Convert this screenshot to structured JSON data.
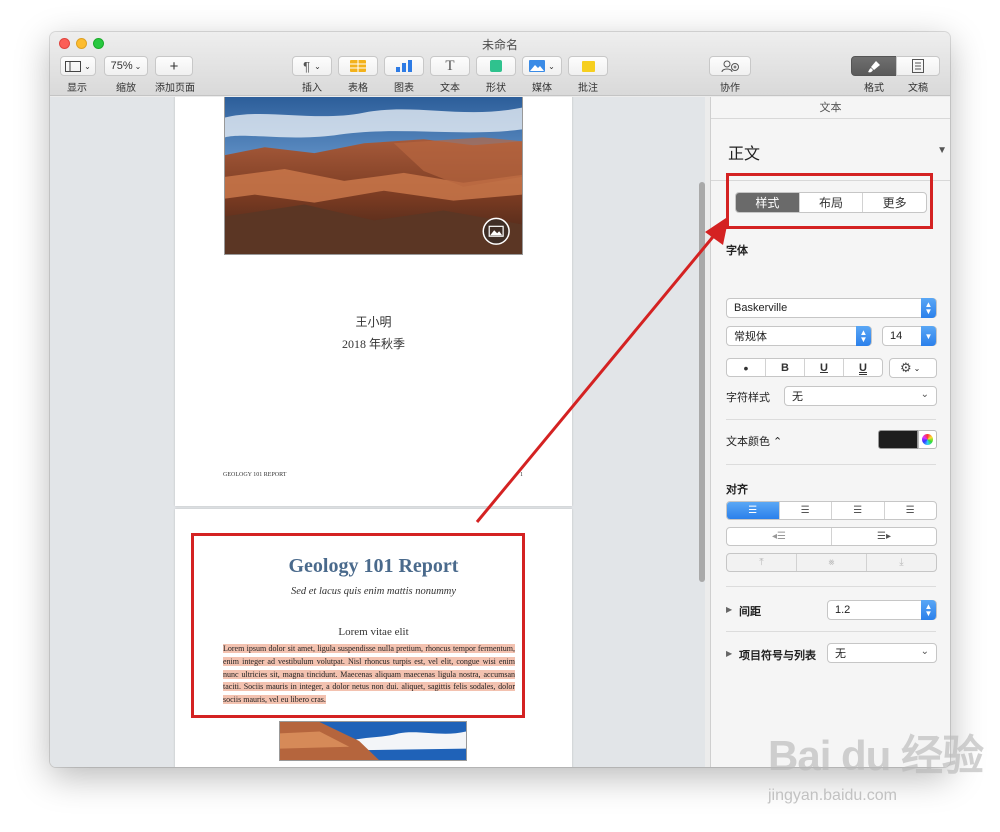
{
  "window": {
    "title": "未命名"
  },
  "toolbar": {
    "view": {
      "label": "显示",
      "icon": "sidebar-layout-icon"
    },
    "zoom": {
      "label": "缩放",
      "value": "75%"
    },
    "add_page": {
      "label": "添加页面",
      "icon": "plus-icon"
    },
    "insert": {
      "label": "插入",
      "icon": "paragraph-icon"
    },
    "table": {
      "label": "表格",
      "icon": "table-icon"
    },
    "chart": {
      "label": "图表",
      "icon": "bar-chart-icon"
    },
    "text": {
      "label": "文本",
      "icon": "text-box-icon"
    },
    "shape": {
      "label": "形状",
      "icon": "shape-icon"
    },
    "media": {
      "label": "媒体",
      "icon": "photo-icon"
    },
    "comment": {
      "label": "批注",
      "icon": "comment-icon"
    },
    "collaborate": {
      "label": "协作",
      "icon": "add-person-icon"
    },
    "format": {
      "label": "格式",
      "icon": "paintbrush-icon"
    },
    "document": {
      "label": "文稿",
      "icon": "document-icon"
    }
  },
  "page1": {
    "author": "王小明",
    "term": "2018 年秋季",
    "footer_left": "GEOLOGY 101 REPORT",
    "page_number": "1"
  },
  "page2": {
    "title": "Geology 101 Report",
    "subtitle": "Sed et lacus quis enim mattis nonummy",
    "heading": "Lorem vitae elit",
    "body": "Lorem ipsum dolor sit amet, ligula suspendisse nulla pretium, rhoncus tempor fermentum, enim integer ad vestibulum volutpat. Nisl rhoncus turpis est, vel elit, congue wisi enim nunc ultricies sit, magna tincidunt. Maecenas aliquam maecenas ligula nostra, accumsan taciti. Sociis mauris in integer, a dolor netus non dui. aliquet, sagittis felis sodales, dolor sociis mauris, vel eu libero cras."
  },
  "inspector": {
    "header": "文本",
    "paragraph_style": "正文",
    "tabs": [
      "样式",
      "布局",
      "更多"
    ],
    "font_section": "字体",
    "font_family": "Baskerville",
    "font_weight": "常规体",
    "font_size": "14",
    "style_buttons": [
      "•",
      "B",
      "U",
      "U"
    ],
    "char_style_label": "字符样式",
    "char_style_value": "无",
    "text_color_label": "文本颜色 ⌃",
    "text_color": "#1e1e1e",
    "align_label": "对齐",
    "spacing_label": "间距",
    "spacing_value": "1.2",
    "bullets_label": "项目符号与列表",
    "bullets_value": "无"
  },
  "watermark": {
    "brand": "Bai du 经验",
    "url": "jingyan.baidu.com"
  },
  "colors": {
    "annotation_red": "#d42222",
    "accent_blue": "#2b80eb",
    "title_blue": "#4a6a8c",
    "selection": "#f3c2b0"
  }
}
